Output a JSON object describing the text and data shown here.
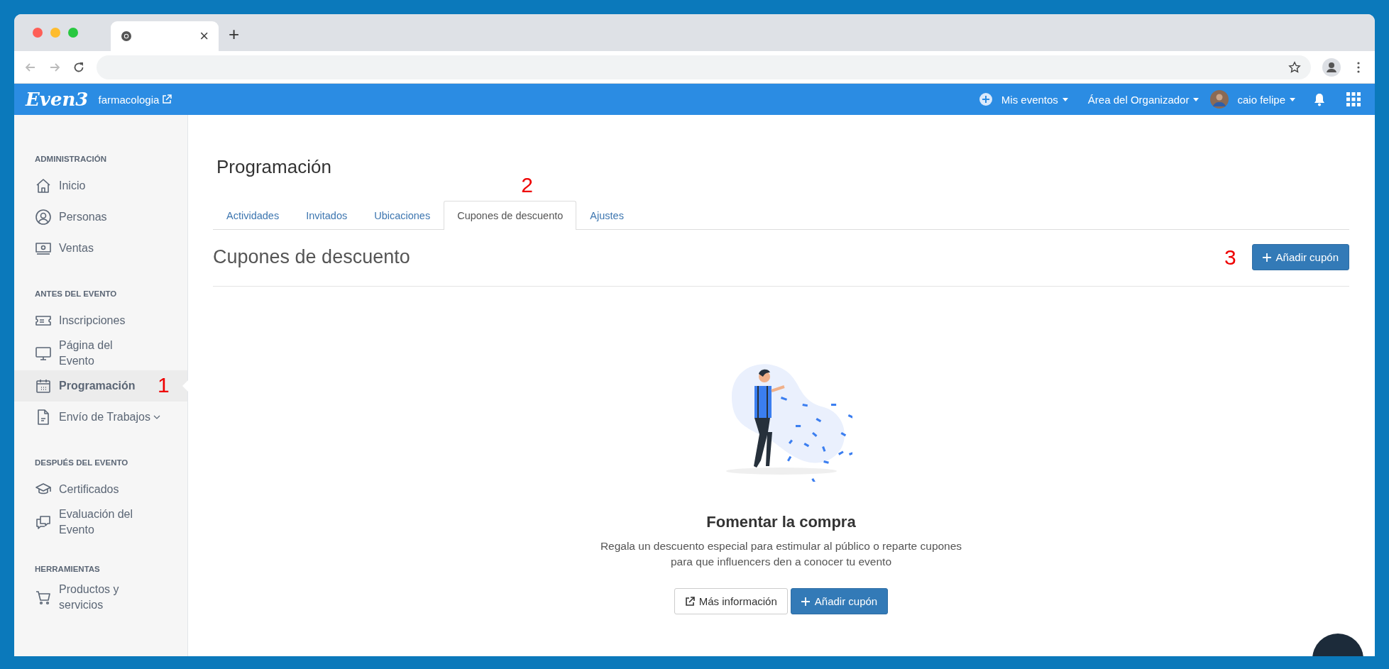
{
  "browser": {
    "tab_close": "×",
    "new_tab": "+"
  },
  "app_bar": {
    "logo": "Even3",
    "event_name": "farmacologia",
    "menus": [
      {
        "label": "Mis eventos",
        "kind": "menu"
      },
      {
        "label": "Área del Organizador",
        "kind": "menu"
      },
      {
        "label": "caio felipe",
        "kind": "user"
      }
    ]
  },
  "sidebar": {
    "sections": [
      {
        "heading": "ADMINISTRACIÓN",
        "items": [
          {
            "label": "Inicio",
            "selected": false
          },
          {
            "label": "Personas",
            "selected": false
          },
          {
            "label": "Ventas",
            "selected": false
          }
        ]
      },
      {
        "heading": "ANTES DEL EVENTO",
        "items": [
          {
            "label": "Inscripciones",
            "selected": false
          },
          {
            "label": "Página del Evento",
            "selected": false
          },
          {
            "label": "Programación",
            "selected": true,
            "annotation": "1"
          },
          {
            "label": "Envío de Trabajos",
            "selected": false,
            "expandable": true
          }
        ]
      },
      {
        "heading": "DESPUÉS DEL EVENTO",
        "items": [
          {
            "label": "Certificados",
            "selected": false
          },
          {
            "label": "Evaluación del Evento",
            "selected": false
          }
        ]
      },
      {
        "heading": "HERRAMIENTAS",
        "items": [
          {
            "label": "Productos y servicios",
            "selected": false
          }
        ]
      }
    ]
  },
  "page_title": "Programación",
  "tabs": [
    {
      "label": "Actividades",
      "selected": false
    },
    {
      "label": "Invitados",
      "selected": false
    },
    {
      "label": "Ubicaciones",
      "selected": false
    },
    {
      "label": "Cupones de descuento",
      "selected": true,
      "annotation": "2"
    },
    {
      "label": "Ajustes",
      "selected": false
    }
  ],
  "section": {
    "title": "Cupones de descuento",
    "annotation": "3",
    "add_button": "Añadir cupón"
  },
  "empty_state": {
    "title": "Fomentar la compra",
    "text": "Regala un descuento especial para estimular al público o reparte cupones para que influencers den a conocer tu evento",
    "buttons": [
      {
        "label": "Más información",
        "kind": "secondary"
      },
      {
        "label": "Añadir cupón",
        "kind": "primary"
      }
    ]
  }
}
